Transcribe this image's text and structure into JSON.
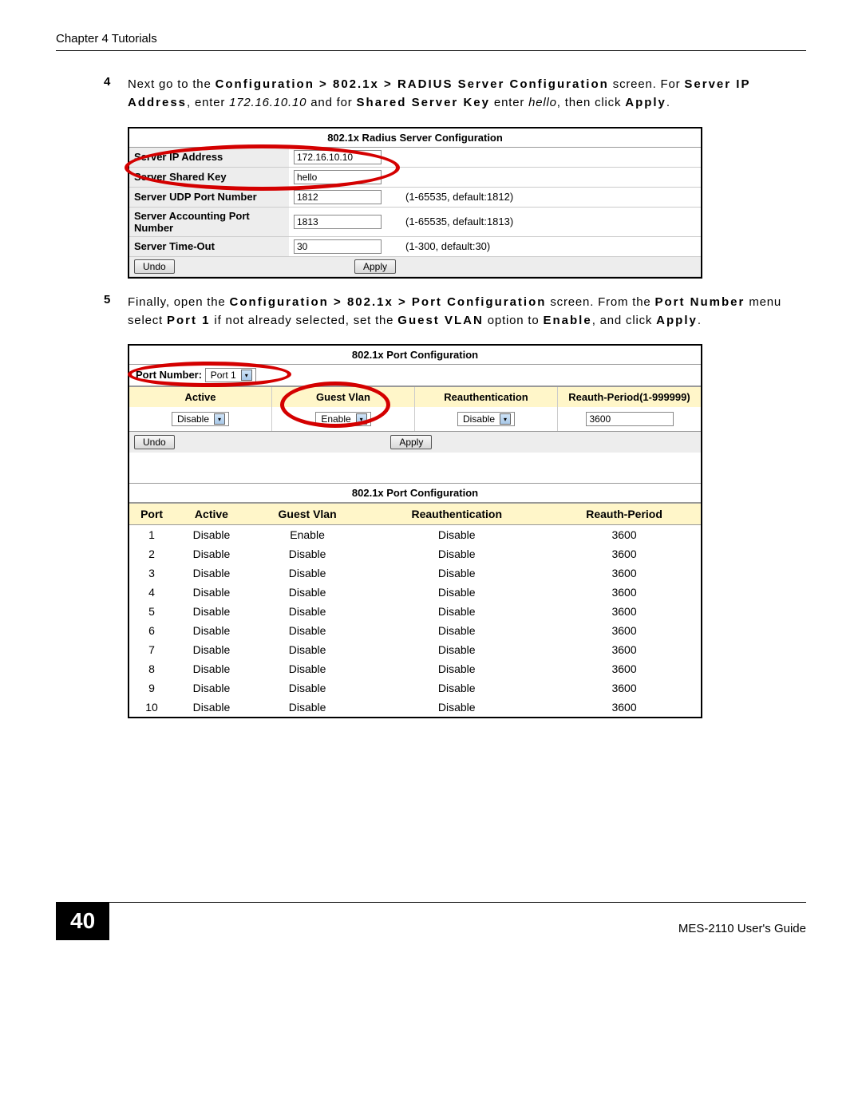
{
  "header": {
    "chapter_title": "Chapter 4 Tutorials"
  },
  "step4": {
    "num": "4",
    "line1a": "Next go to the ",
    "nav1": "Configuration > 802.1x > RADIUS Server Configuration",
    "line1b": " screen. For ",
    "bold1": "Server IP Address",
    "line1c": ", enter ",
    "ital1": "172.16.10.10",
    "line1d": " and for ",
    "bold2": "Shared Server Key",
    "line1e": " enter ",
    "ital2": "hello",
    "line1f": ", then click ",
    "bold3": "Apply",
    "line1g": "."
  },
  "radius": {
    "title": "802.1x Radius Server Configuration",
    "rows": {
      "ip_label": "Server IP Address",
      "ip_value": "172.16.10.10",
      "key_label": "Server Shared Key",
      "key_value": "hello",
      "udp_label": "Server UDP Port Number",
      "udp_value": "1812",
      "udp_hint": "(1-65535, default:1812)",
      "acc_label": "Server Accounting Port Number",
      "acc_value": "1813",
      "acc_hint": "(1-65535, default:1813)",
      "to_label": "Server Time-Out",
      "to_value": "30",
      "to_hint": "(1-300, default:30)"
    },
    "undo": "Undo",
    "apply": "Apply"
  },
  "step5": {
    "num": "5",
    "a": "Finally, open the ",
    "nav": "Configuration > 802.1x > Port Configuration",
    "b": " screen. From the ",
    "bold1": "Port Number",
    "c": " menu select ",
    "bold2": "Port 1",
    "d": " if not already selected, set the ",
    "bold3": "Guest VLAN",
    "e": " option to ",
    "bold4": "Enable",
    "f": ", and click ",
    "bold5": "Apply",
    "g": "."
  },
  "portconf": {
    "title": "802.1x Port Configuration",
    "portnum_label": "Port Number:",
    "portnum_value": "Port 1",
    "cols": {
      "active": "Active",
      "guest": "Guest Vlan",
      "reauth": "Reauthentication",
      "period": "Reauth-Period(1-999999)"
    },
    "values": {
      "active": "Disable",
      "guest": "Enable",
      "reauth": "Disable",
      "period": "3600"
    },
    "undo": "Undo",
    "apply": "Apply"
  },
  "status": {
    "title": "802.1x Port Configuration",
    "headers": {
      "port": "Port",
      "active": "Active",
      "guest": "Guest Vlan",
      "reauth": "Reauthentication",
      "period": "Reauth-Period"
    },
    "rows": [
      {
        "port": "1",
        "active": "Disable",
        "guest": "Enable",
        "reauth": "Disable",
        "period": "3600"
      },
      {
        "port": "2",
        "active": "Disable",
        "guest": "Disable",
        "reauth": "Disable",
        "period": "3600"
      },
      {
        "port": "3",
        "active": "Disable",
        "guest": "Disable",
        "reauth": "Disable",
        "period": "3600"
      },
      {
        "port": "4",
        "active": "Disable",
        "guest": "Disable",
        "reauth": "Disable",
        "period": "3600"
      },
      {
        "port": "5",
        "active": "Disable",
        "guest": "Disable",
        "reauth": "Disable",
        "period": "3600"
      },
      {
        "port": "6",
        "active": "Disable",
        "guest": "Disable",
        "reauth": "Disable",
        "period": "3600"
      },
      {
        "port": "7",
        "active": "Disable",
        "guest": "Disable",
        "reauth": "Disable",
        "period": "3600"
      },
      {
        "port": "8",
        "active": "Disable",
        "guest": "Disable",
        "reauth": "Disable",
        "period": "3600"
      },
      {
        "port": "9",
        "active": "Disable",
        "guest": "Disable",
        "reauth": "Disable",
        "period": "3600"
      },
      {
        "port": "10",
        "active": "Disable",
        "guest": "Disable",
        "reauth": "Disable",
        "period": "3600"
      }
    ]
  },
  "footer": {
    "page": "40",
    "guide": "MES-2110 User's Guide"
  }
}
